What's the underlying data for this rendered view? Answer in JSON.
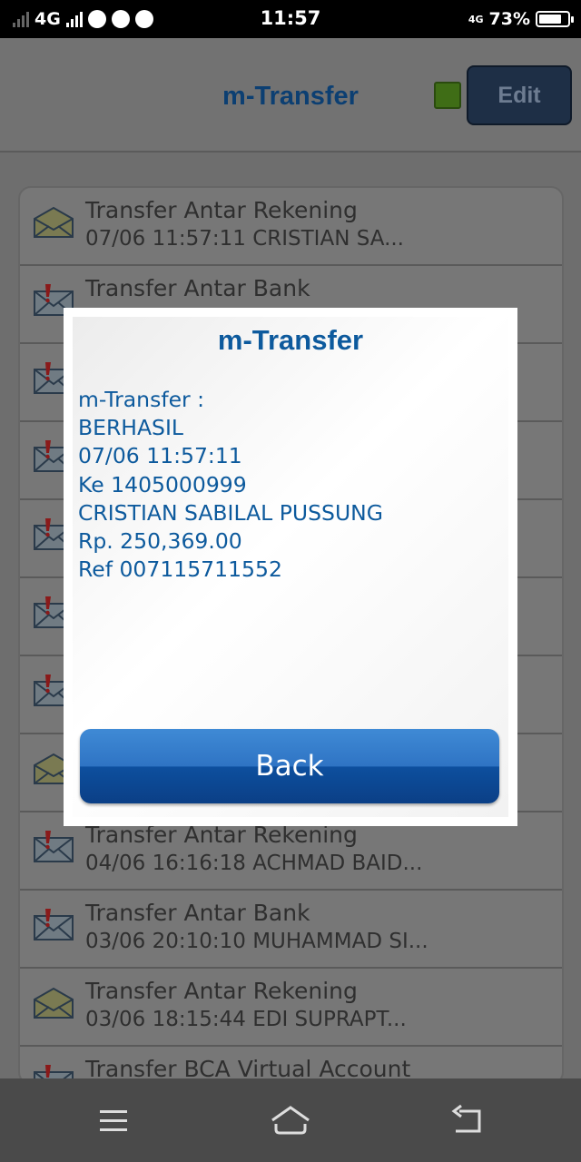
{
  "status_bar": {
    "network": "4G",
    "time": "11:57",
    "network_right": "4G",
    "battery": "73%"
  },
  "header": {
    "title": "m-Transfer",
    "edit_label": "Edit",
    "status_color": "#3f6d16"
  },
  "list": {
    "items": [
      {
        "title": "Transfer Antar Rekening",
        "subtitle": "07/06 11:57:11 CRISTIAN SA...",
        "icon": "envelope-open-icon"
      },
      {
        "title": "Transfer Antar Bank",
        "subtitle": "",
        "icon": "envelope-alert-icon"
      },
      {
        "title": "",
        "subtitle": "",
        "icon": "envelope-alert-icon"
      },
      {
        "title": "",
        "subtitle": "",
        "icon": "envelope-alert-icon"
      },
      {
        "title": "",
        "subtitle": "",
        "icon": "envelope-alert-icon"
      },
      {
        "title": "",
        "subtitle": "",
        "icon": "envelope-alert-icon"
      },
      {
        "title": "",
        "subtitle": "",
        "icon": "envelope-alert-icon"
      },
      {
        "title": "",
        "subtitle": "",
        "icon": "envelope-open-icon"
      },
      {
        "title": "Transfer Antar Rekening",
        "subtitle": "04/06 16:16:18 ACHMAD BAID...",
        "icon": "envelope-alert-icon"
      },
      {
        "title": "Transfer Antar Bank",
        "subtitle": "03/06 20:10:10 MUHAMMAD SI...",
        "icon": "envelope-alert-icon"
      },
      {
        "title": "Transfer Antar Rekening",
        "subtitle": "03/06 18:15:44 EDI SUPRAPT...",
        "icon": "envelope-open-icon"
      },
      {
        "title": "Transfer BCA Virtual Account",
        "subtitle": "",
        "icon": "envelope-alert-icon"
      }
    ]
  },
  "dialog": {
    "title": "m-Transfer",
    "lines": [
      "m-Transfer :",
      "BERHASIL",
      "07/06 11:57:11",
      "Ke 1405000999",
      "CRISTIAN SABILAL PUSSUNG",
      "Rp. 250,369.00",
      "Ref 007115711552"
    ],
    "button_label": "Back"
  },
  "navbar": {
    "items": [
      "menu-icon",
      "home-icon",
      "back-icon"
    ]
  },
  "colors": {
    "accent": "#0d5a9d",
    "button_top": "#3f8ad5",
    "button_bottom": "#0b3f86"
  }
}
